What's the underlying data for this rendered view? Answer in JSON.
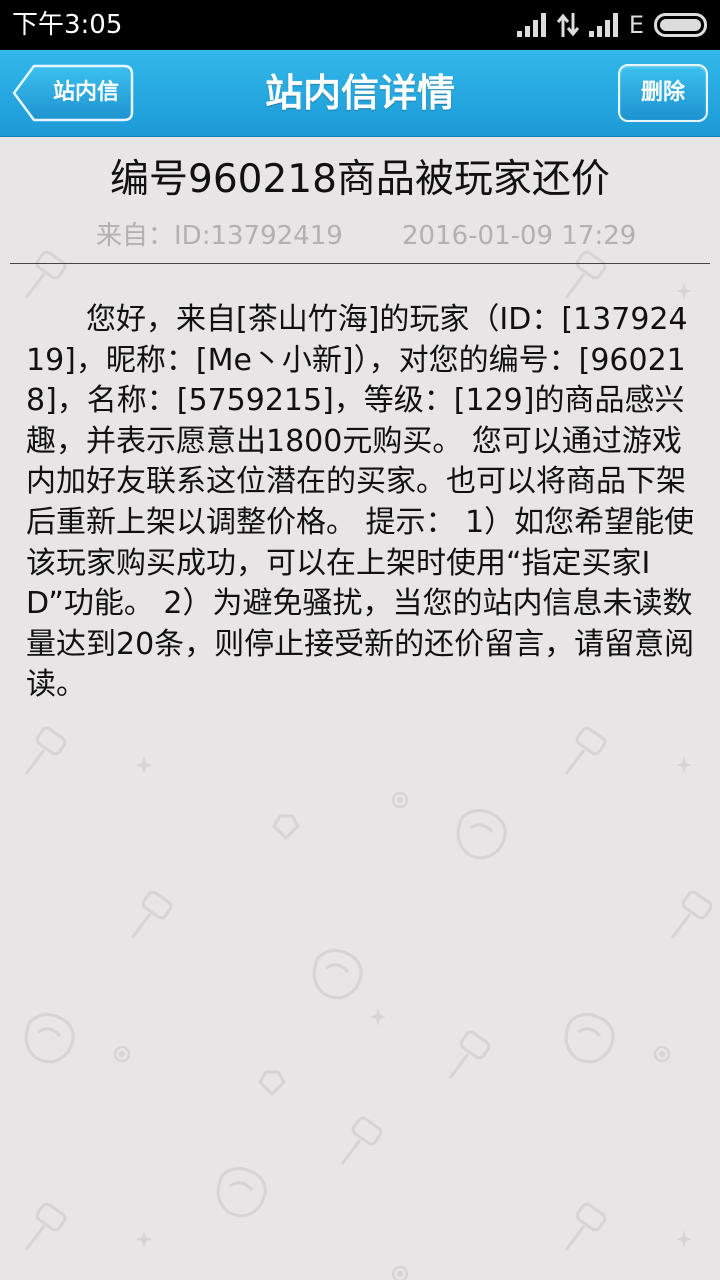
{
  "status_bar": {
    "time": "下午3:05",
    "network_type": "E",
    "icons": [
      "signal-icon",
      "data-transfer-icon",
      "signal-icon",
      "battery-icon"
    ]
  },
  "header": {
    "back_label": "站内信",
    "title": "站内信详情",
    "delete_label": "删除"
  },
  "message": {
    "title": "编号960218商品被玩家还价",
    "from": "来自：ID:13792419",
    "date": "2016-01-09 17:29",
    "body": "您好，来自[茶山竹海]的玩家（ID：[13792419]，昵称：[Me丶小新]），对您的编号：[960218]，名称：[5759215]，等级：[129]的商品感兴趣，并表示愿意出1800元购买。 您可以通过游戏内加好友联系这位潜在的买家。也可以将商品下架后重新上架以调整价格。 提示： 1）如您希望能使该玩家购买成功，可以在上架时使用“指定买家ID”功能。 2）为避免骚扰，当您的站内信息未读数量达到20条，则停止接受新的还价留言，请留意阅读。"
  },
  "colors": {
    "header_blue": "#1c9ad6",
    "background": "#e8e5e6",
    "meta_gray": "#b3b0b1"
  }
}
